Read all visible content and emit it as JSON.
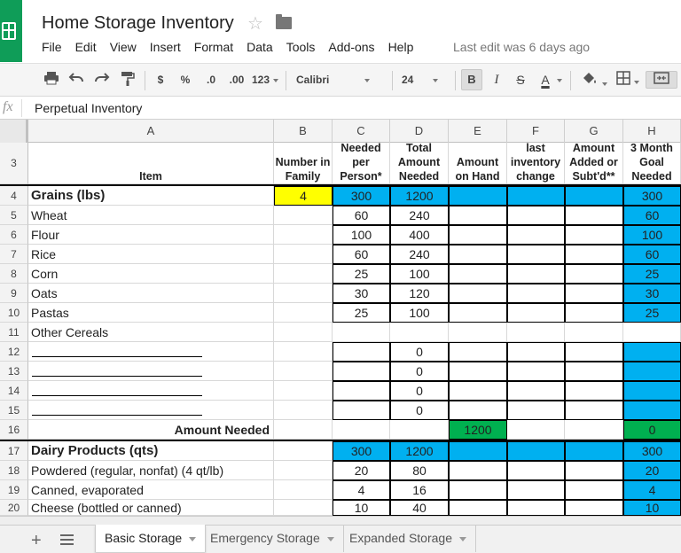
{
  "header": {
    "title": "Home Storage Inventory",
    "menu": [
      "File",
      "Edit",
      "View",
      "Insert",
      "Format",
      "Data",
      "Tools",
      "Add-ons",
      "Help"
    ],
    "last_edit": "Last edit was 6 days ago"
  },
  "toolbar": {
    "currency": "$",
    "percent": "%",
    "decrease_decimal": ".0",
    "increase_decimal": ".00",
    "number_format": "123",
    "font": "Calibri",
    "font_size": "24",
    "bold": "B",
    "italic": "I",
    "strike": "S",
    "text_color": "A"
  },
  "formula": {
    "fx": "fx",
    "content": "Perpetual Inventory"
  },
  "columns": [
    "A",
    "B",
    "C",
    "D",
    "E",
    "F",
    "G",
    "H"
  ],
  "header_row": {
    "num": "3",
    "item": "Item",
    "number_in_family": "Number in Family",
    "needed_per_person": "Needed per Person*",
    "total_amount_needed": "Total Amount Needed",
    "amount_on_hand": "Amount on Hand",
    "last_inventory_change": "last inventory change",
    "amount_added": "Amount Added or Subt'd**",
    "goal_needed": "3 Month Goal Needed"
  },
  "rows": {
    "r4": {
      "num": "4",
      "a": "Grains (lbs)",
      "b": "4",
      "c": "300",
      "d": "1200",
      "h": "300"
    },
    "r5": {
      "num": "5",
      "a": "Wheat",
      "c": "60",
      "d": "240",
      "h": "60"
    },
    "r6": {
      "num": "6",
      "a": "Flour",
      "c": "100",
      "d": "400",
      "h": "100"
    },
    "r7": {
      "num": "7",
      "a": "Rice",
      "c": "60",
      "d": "240",
      "h": "60"
    },
    "r8": {
      "num": "8",
      "a": "Corn",
      "c": "25",
      "d": "100",
      "h": "25"
    },
    "r9": {
      "num": "9",
      "a": "Oats",
      "c": "30",
      "d": "120",
      "h": "30"
    },
    "r10": {
      "num": "10",
      "a": "Pastas",
      "c": "25",
      "d": "100",
      "h": "25"
    },
    "r11": {
      "num": "11",
      "a": "Other Cereals"
    },
    "r12": {
      "num": "12",
      "d": "0"
    },
    "r13": {
      "num": "13",
      "d": "0"
    },
    "r14": {
      "num": "14",
      "d": "0"
    },
    "r15": {
      "num": "15",
      "d": "0"
    },
    "r16": {
      "num": "16",
      "a": "Amount Needed",
      "e": "1200",
      "h": "0"
    },
    "r17": {
      "num": "17",
      "a": "Dairy Products (qts)",
      "c": "300",
      "d": "1200",
      "h": "300"
    },
    "r18": {
      "num": "18",
      "a": "Powdered (regular, nonfat) (4 qt/lb)",
      "c": "20",
      "d": "80",
      "h": "20"
    },
    "r19": {
      "num": "19",
      "a": "Canned, evaporated",
      "c": "4",
      "d": "16",
      "h": "4"
    },
    "r20": {
      "num": "20",
      "a": "Cheese (bottled or canned)",
      "c": "10",
      "d": "40",
      "h": "10"
    }
  },
  "sheets": [
    "Basic Storage",
    "Emergency Storage",
    "Expanded Storage"
  ],
  "colors": {
    "blue": "#00b0f0",
    "yellow": "#ffff00",
    "green": "#00b050",
    "brand": "#0f9d58"
  }
}
